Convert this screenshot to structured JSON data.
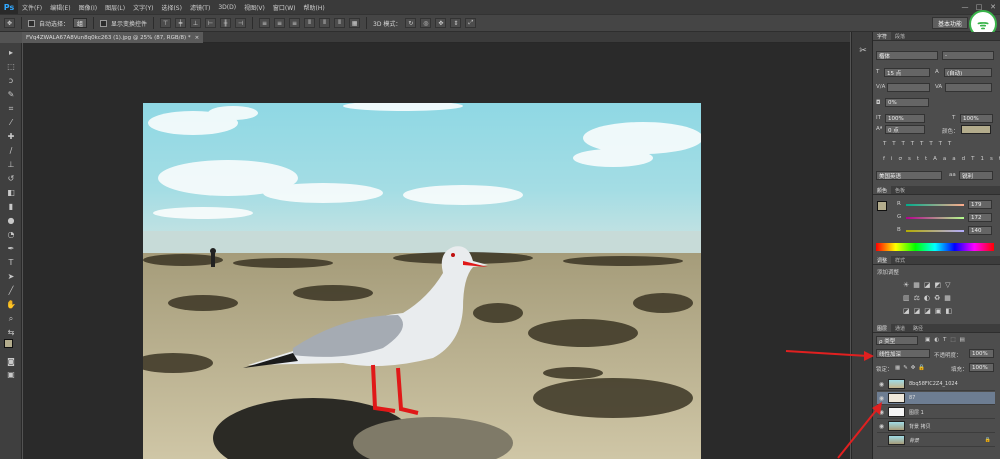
{
  "app": {
    "logo": "Ps"
  },
  "menubar": {
    "items": [
      "文件(F)",
      "编辑(E)",
      "图像(I)",
      "图层(L)",
      "文字(Y)",
      "选择(S)",
      "滤镜(T)",
      "3D(D)",
      "视图(V)",
      "窗口(W)",
      "帮助(H)"
    ]
  },
  "window_controls": {
    "minimize": "—",
    "maximize": "□",
    "close": "✕"
  },
  "options": {
    "auto_select_label": "自动选择：",
    "auto_select_value": "组",
    "show_transform_label": "显示变换控件",
    "mode3d_label": "3D 模式：",
    "workspace": "基本功能"
  },
  "document": {
    "tab_title": "FVq4ZWALA67A8Vun8q0kc263 (1).jpg @ 25% (87, RGB/8) *",
    "tab_close": "×"
  },
  "character": {
    "tabs": [
      "字符",
      "段落"
    ],
    "font_family": "楷体",
    "font_style": "-",
    "font_size": "15 点",
    "leading": "(自动)",
    "tracking_pair": "",
    "tracking": "0%",
    "scale_v": "100%",
    "scale_h": "100%",
    "baseline": "0 点",
    "color_label": "颜色：",
    "language": "美国英语",
    "antialias": "锐利"
  },
  "color_panel": {
    "tabs": [
      "颜色",
      "色板"
    ],
    "r_label": "R",
    "r": "179",
    "g_label": "G",
    "g": "172",
    "b_label": "B",
    "b": "140",
    "swatch": "#b3ac8c"
  },
  "adjust_panel": {
    "tabs": [
      "调整",
      "样式"
    ],
    "title": "添加调整"
  },
  "layers": {
    "tabs": [
      "图层",
      "通道",
      "路径"
    ],
    "filter": "ρ 类型",
    "blend_mode": "线性加深",
    "opacity_label": "不透明度：",
    "opacity": "100%",
    "lock_label": "锁定：",
    "fill_label": "填充：",
    "fill": "100%",
    "items": [
      {
        "name": "8bq58FIC2Z4_1024",
        "visible": true
      },
      {
        "name": "87",
        "visible": true
      },
      {
        "name": "图层 1",
        "visible": true
      },
      {
        "name": "背景 拷贝",
        "visible": true
      },
      {
        "name": "背景",
        "visible": false
      }
    ]
  },
  "colors": {
    "accent_arrow": "#e02020",
    "selected_layer": "#6d7d92",
    "wifi": "#39b34a"
  }
}
